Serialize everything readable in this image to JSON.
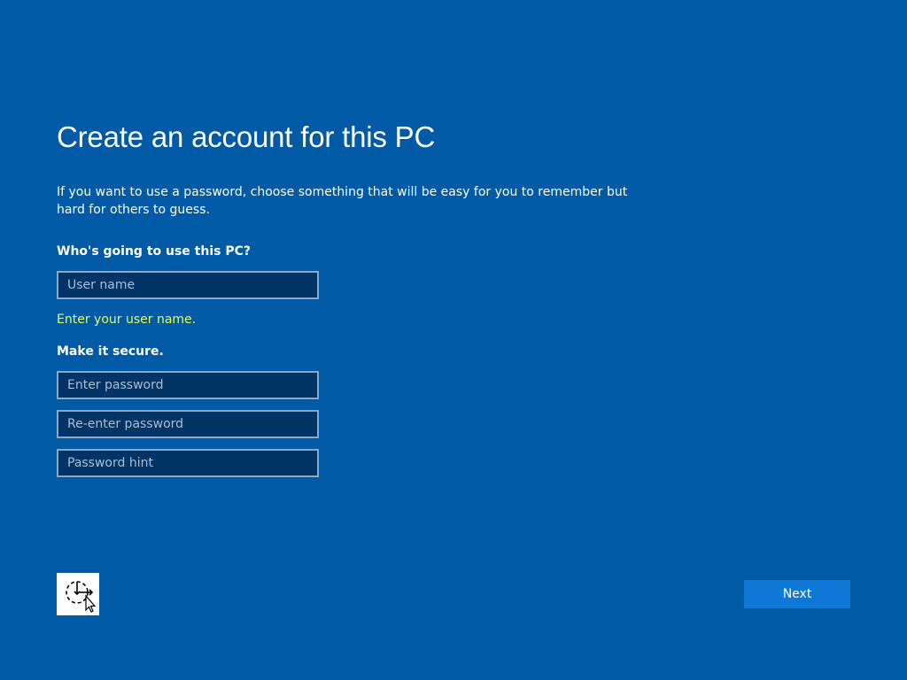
{
  "page": {
    "title": "Create an account for this PC",
    "description": "If you want to use a password, choose something that will be easy for you to remember but hard for others to guess."
  },
  "who_section": {
    "heading": "Who's going to use this PC?",
    "username_placeholder": "User name",
    "username_value": "",
    "error_message": "Enter your user name."
  },
  "secure_section": {
    "heading": "Make it secure.",
    "password_placeholder": "Enter password",
    "reenter_placeholder": "Re-enter password",
    "hint_placeholder": "Password hint"
  },
  "footer": {
    "ease_of_access_icon": "ease-of-access-icon",
    "next_label": "Next"
  },
  "colors": {
    "background": "#005aa5",
    "field_background": "#003466",
    "field_border": "#8aa8c8",
    "error_text": "#e6ff5c",
    "next_button": "#0f78d7"
  }
}
